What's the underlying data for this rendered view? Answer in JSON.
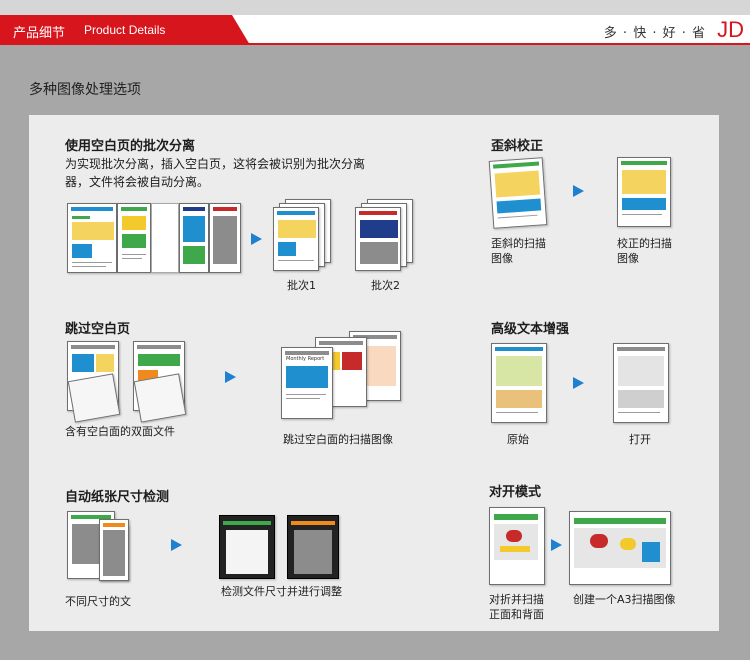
{
  "header": {
    "tab_cn": "产品细节",
    "tab_en": "Product Details",
    "slogan": "多 · 快 · 好 · 省",
    "logo": "JD",
    "accent_color": "#d7151c"
  },
  "section_title": "多种图像处理选项",
  "features": {
    "batch": {
      "title": "使用空白页的批次分离",
      "desc_line1": "为实现批次分离，插入空白页，这将会被识别为批次分离",
      "desc_line2": "器，文件将会被自动分离。",
      "label1": "批次1",
      "label2": "批次2"
    },
    "deskew": {
      "title": "歪斜校正",
      "label_before_1": "歪斜的扫描",
      "label_before_2": "图像",
      "label_after_1": "校正的扫描",
      "label_after_2": "图像"
    },
    "skip_blank": {
      "title": "跳过空白页",
      "label_before": "含有空白面的双面文件",
      "label_after": "跳过空白面的扫描图像",
      "doc_header": "Monthly Report"
    },
    "text_enhance": {
      "title": "高级文本增强",
      "label_before": "原始",
      "label_after": "打开"
    },
    "auto_size": {
      "title": "自动纸张尺寸检测",
      "label_before": "不同尺寸的文",
      "label_after": "检测文件尺寸并进行调整"
    },
    "folio": {
      "title": "对开模式",
      "label_before_1": "对折并扫描",
      "label_before_2": "正面和背面",
      "label_after": "创建一个A3扫描图像"
    }
  }
}
